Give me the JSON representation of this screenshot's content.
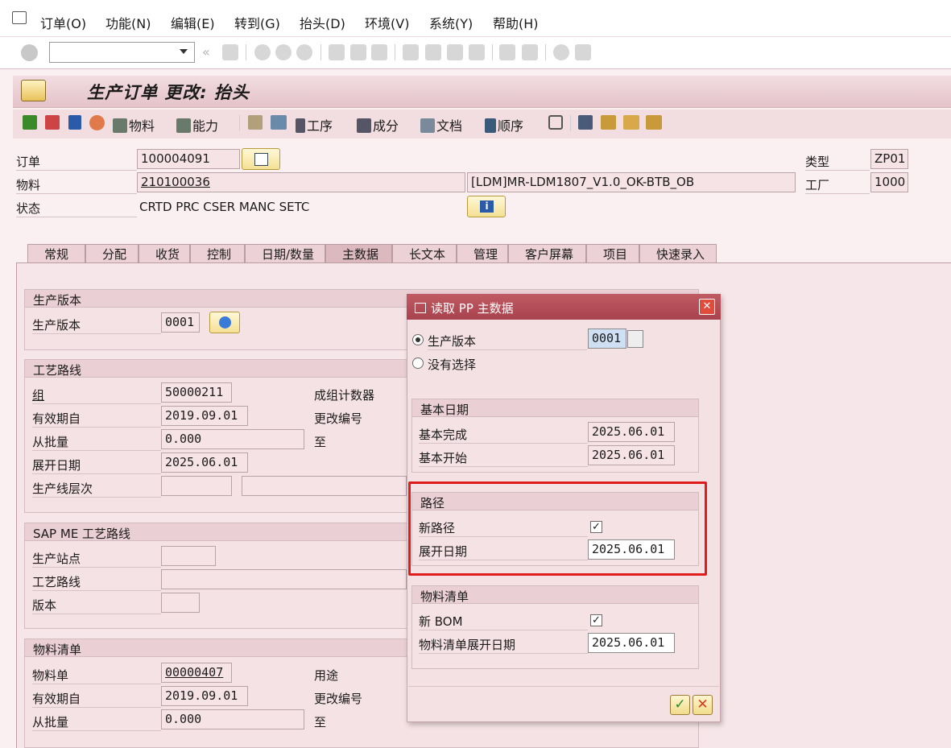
{
  "menu": [
    "订单(O)",
    "功能(N)",
    "编辑(E)",
    "转到(G)",
    "抬头(D)",
    "环境(V)",
    "系统(Y)",
    "帮助(H)"
  ],
  "title": "生产订单 更改: 抬头",
  "app_toolbar": {
    "material": "物料",
    "capacity": "能力",
    "operations": "工序",
    "components": "成分",
    "documents": "文档",
    "sequence": "顺序"
  },
  "header": {
    "order_label": "订单",
    "order_value": "100004091",
    "material_label": "物料",
    "material_value": "210100036",
    "material_desc": "[LDM]MR-LDM1807_V1.0_OK-BTB_OB",
    "status_label": "状态",
    "status_value": "CRTD PRC  CSER MANC SETC",
    "type_label": "类型",
    "type_value": "ZP01",
    "plant_label": "工厂",
    "plant_value": "1000"
  },
  "tabs": [
    "常规",
    "分配",
    "收货",
    "控制",
    "日期/数量",
    "主数据",
    "长文本",
    "管理",
    "客户屏幕",
    "项目",
    "快速录入"
  ],
  "active_tab": "主数据",
  "production_version": {
    "title": "生产版本",
    "label": "生产版本",
    "value": "0001"
  },
  "routing": {
    "title": "工艺路线",
    "group_label": "组",
    "group_value": "50000211",
    "valid_from_label": "有效期自",
    "valid_from_value": "2019.09.01",
    "from_lot_label": "从批量",
    "from_lot_value": "0.000",
    "explode_date_label": "展开日期",
    "explode_date_value": "2025.06.01",
    "line_level_label": "生产线层次",
    "group_counter_label": "成组计数器",
    "change_no_label": "更改编号",
    "to_label": "至"
  },
  "sapme": {
    "title": "SAP ME 工艺路线",
    "station_label": "生产站点",
    "routing_label": "工艺路线",
    "version_label": "版本"
  },
  "bom": {
    "title": "物料清单",
    "bom_label": "物料单",
    "bom_value": "00000407",
    "valid_from_label": "有效期自",
    "valid_from_value": "2019.09.01",
    "from_lot_label": "从批量",
    "from_lot_value": "0.000",
    "usage_label": "用途",
    "change_no_label": "更改编号",
    "to_label": "至"
  },
  "dialog": {
    "title": "读取 PP 主数据",
    "opt_version_label": "生产版本",
    "opt_version_value": "0001",
    "opt_none_label": "没有选择",
    "basic_dates_title": "基本日期",
    "basic_finish_label": "基本完成",
    "basic_finish_value": "2025.06.01",
    "basic_start_label": "基本开始",
    "basic_start_value": "2025.06.01",
    "routing_title": "路径",
    "new_routing_label": "新路径",
    "routing_explode_label": "展开日期",
    "routing_explode_value": "2025.06.01",
    "bom_title": "物料清单",
    "new_bom_label": "新 BOM",
    "bom_explode_label": "物料清单展开日期",
    "bom_explode_value": "2025.06.01",
    "check_mark": "✓",
    "close_mark": "✕"
  }
}
